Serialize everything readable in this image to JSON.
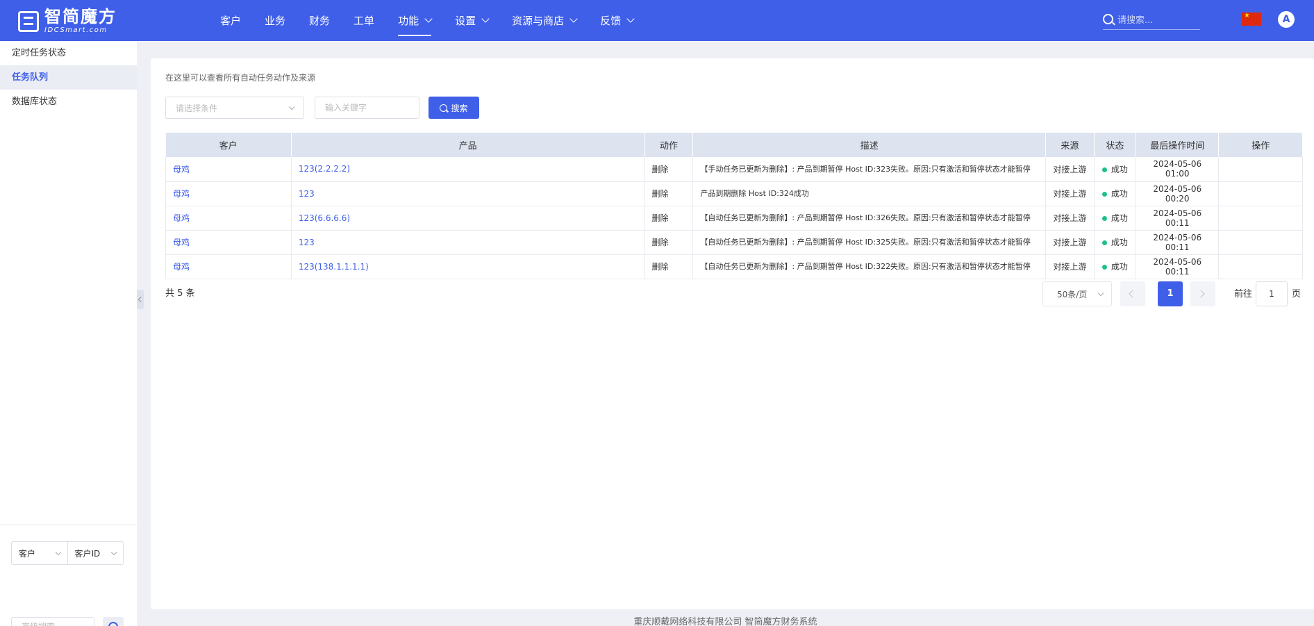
{
  "brand": {
    "name_cn": "智简魔方",
    "name_en": "IDCSmart.com"
  },
  "nav": {
    "items": [
      {
        "label": "客户",
        "dropdown": false,
        "active": false
      },
      {
        "label": "业务",
        "dropdown": false,
        "active": false
      },
      {
        "label": "财务",
        "dropdown": false,
        "active": false
      },
      {
        "label": "工单",
        "dropdown": false,
        "active": false
      },
      {
        "label": "功能",
        "dropdown": true,
        "active": true
      },
      {
        "label": "设置",
        "dropdown": true,
        "active": false
      },
      {
        "label": "资源与商店",
        "dropdown": true,
        "active": false
      },
      {
        "label": "反馈",
        "dropdown": true,
        "active": false
      }
    ],
    "search_placeholder": "请搜索...",
    "avatar_letter": "A",
    "accent_color": "#3f5fe8"
  },
  "sidebar": {
    "items": [
      {
        "label": "定时任务状态",
        "active": false
      },
      {
        "label": "任务队列",
        "active": true
      },
      {
        "label": "数据库状态",
        "active": false
      }
    ],
    "filter_type": "客户",
    "filter_field": "客户ID",
    "adv_search_placeholder": "高级搜索"
  },
  "main": {
    "hint": "在这里可以查看所有自动任务动作及来源",
    "condition_placeholder": "请选择条件",
    "keyword_placeholder": "输入关键字",
    "search_label": "搜索",
    "columns": [
      "客户",
      "产品",
      "动作",
      "描述",
      "来源",
      "状态",
      "最后操作时间",
      "操作"
    ],
    "rows": [
      {
        "customer": "母鸡",
        "product": "123(2.2.2.2)",
        "action": "删除",
        "desc": "【手动任务已更新为删除】: 产品到期暂停 Host ID:323失败。原因:只有激活和暂停状态才能暂停",
        "source": "对接上游",
        "status": "成功",
        "time": "2024-05-06 01:00"
      },
      {
        "customer": "母鸡",
        "product": "123",
        "action": "删除",
        "desc": "产品到期删除 Host ID:324成功",
        "source": "对接上游",
        "status": "成功",
        "time": "2024-05-06 00:20"
      },
      {
        "customer": "母鸡",
        "product": "123(6.6.6.6)",
        "action": "删除",
        "desc": "【自动任务已更新为删除】: 产品到期暂停 Host ID:326失败。原因:只有激活和暂停状态才能暂停",
        "source": "对接上游",
        "status": "成功",
        "time": "2024-05-06 00:11"
      },
      {
        "customer": "母鸡",
        "product": "123",
        "action": "删除",
        "desc": "【自动任务已更新为删除】: 产品到期暂停 Host ID:325失败。原因:只有激活和暂停状态才能暂停",
        "source": "对接上游",
        "status": "成功",
        "time": "2024-05-06 00:11"
      },
      {
        "customer": "母鸡",
        "product": "123(138.1.1.1.1)",
        "action": "删除",
        "desc": "【自动任务已更新为删除】: 产品到期暂停 Host ID:322失败。原因:只有激活和暂停状态才能暂停",
        "source": "对接上游",
        "status": "成功",
        "time": "2024-05-06 00:11"
      }
    ],
    "status_color": "#1dbf8e",
    "total_label": "共 5 条",
    "page_size": "50条/页",
    "current_page": "1",
    "goto_prefix": "前往",
    "goto_value": "1",
    "goto_suffix": "页"
  },
  "footer": "重庆顺戴网络科技有限公司 智简魔方财务系统"
}
